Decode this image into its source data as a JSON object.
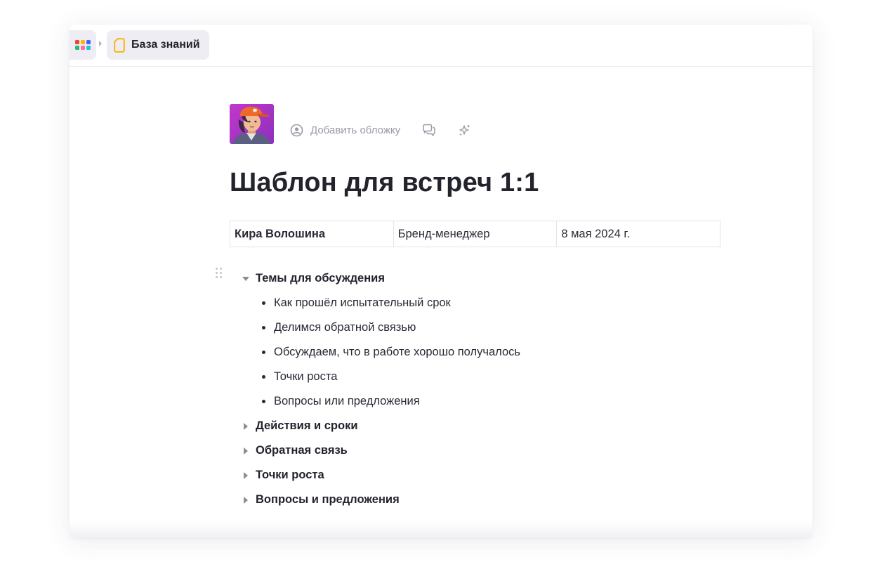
{
  "topbar": {
    "apps_icon": "apps-grid-icon",
    "apps_colors": [
      "#f0433a",
      "#ffb400",
      "#4262ff",
      "#26bd6c",
      "#ff6e9c",
      "#27c4d9"
    ],
    "breadcrumb": {
      "icon": "document-icon",
      "icon_color": "#ffb000",
      "label": "База знаний"
    }
  },
  "doc": {
    "tools": {
      "add_cover_icon": "cover-icon",
      "add_cover_label": "Добавить обложку",
      "comment_icon": "comments-icon",
      "ai_icon": "sparkles-icon"
    },
    "title": "Шаблон для встреч 1:1",
    "meta_table": {
      "name": "Кира Волошина",
      "role": "Бренд-менеджер",
      "date": "8 мая 2024 г."
    },
    "sections": [
      {
        "title": "Темы для обсуждения",
        "expanded": true,
        "items": [
          "Как прошёл испытательный срок",
          "Делимся обратной связью",
          "Обсуждаем, что в работе хорошо получалось",
          "Точки роста",
          "Вопросы или предложения"
        ]
      },
      {
        "title": "Действия и сроки",
        "expanded": false
      },
      {
        "title": "Обратная связь",
        "expanded": false
      },
      {
        "title": "Точки роста",
        "expanded": false
      },
      {
        "title": "Вопросы и предложения",
        "expanded": false
      }
    ]
  }
}
